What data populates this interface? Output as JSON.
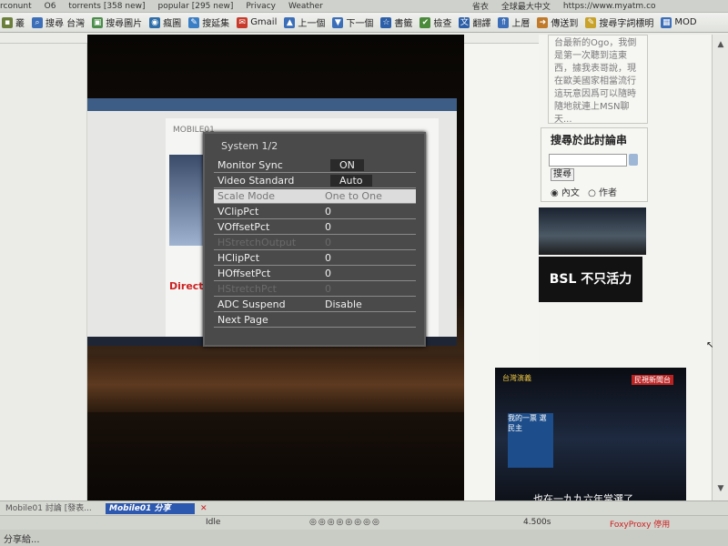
{
  "browser": {
    "top_bookmarks": [
      "rconunt",
      "O6",
      "torrents [358 new]",
      "popular [295 new]",
      "Privacy",
      "Weather",
      "省衣",
      "全球最大中文",
      "https://www.myatm.co"
    ],
    "toolbar": [
      {
        "icon": "fold-icon",
        "label": "叢"
      },
      {
        "icon": "search-icon",
        "label": "搜尋 台灣"
      },
      {
        "icon": "image-icon",
        "label": "搜尋圖片"
      },
      {
        "icon": "blog-icon",
        "label": "瘋圖"
      },
      {
        "icon": "bookmark-icon",
        "label": "搜延集"
      },
      {
        "icon": "gmail-icon",
        "label": "Gmail"
      },
      {
        "icon": "up-icon",
        "label": "上一個"
      },
      {
        "icon": "down-icon",
        "label": "下一個"
      },
      {
        "icon": "star-icon",
        "label": "書籤"
      },
      {
        "icon": "check-icon",
        "label": "檢查"
      },
      {
        "icon": "translate-icon",
        "label": "翻譯"
      },
      {
        "icon": "upload-icon",
        "label": "上層"
      },
      {
        "icon": "send-icon",
        "label": "傳送到"
      },
      {
        "icon": "spell-icon",
        "label": "搜尋字詞標明"
      },
      {
        "icon": "mod-icon",
        "label": "MOD"
      }
    ]
  },
  "osd": {
    "title": "System 1/2",
    "rows": [
      {
        "label": "Monitor Sync",
        "value": "ON",
        "state": "boxed"
      },
      {
        "label": "Video Standard",
        "value": "Auto",
        "state": "boxed"
      },
      {
        "label": "Scale Mode",
        "value": "One to One",
        "state": "selected"
      },
      {
        "label": "VClipPct",
        "value": "0",
        "state": "normal"
      },
      {
        "label": "VOffsetPct",
        "value": "0",
        "state": "normal"
      },
      {
        "label": "HStretchOutput",
        "value": "0",
        "state": "disabled"
      },
      {
        "label": "HClipPct",
        "value": "0",
        "state": "normal"
      },
      {
        "label": "HOffsetPct",
        "value": "0",
        "state": "normal"
      },
      {
        "label": "HStretchPct",
        "value": "0",
        "state": "disabled"
      },
      {
        "label": "ADC Suspend",
        "value": "Disable",
        "state": "normal"
      },
      {
        "label": "Next Page",
        "value": "",
        "state": "normal"
      }
    ]
  },
  "monitor_page": {
    "logo": "MOBILE01",
    "ad": "Direct."
  },
  "sidebar": {
    "snippet": "台最新的Ogo，我倒是第一次聽到這東西，據我表哥說，現在歐美國家相當流行這玩意因爲可以隨時隨地就連上MSN聊天...",
    "search_title": "搜尋於此討論串",
    "search_button": "搜尋",
    "radio_content": "內文",
    "radio_author": "作者",
    "bsl_text": "BSL 不只活力"
  },
  "tv": {
    "logo": "台灣演義",
    "channel": "民視新聞台",
    "subtitle": "也在一九九六年當選了",
    "banner": "我的一票 選民主"
  },
  "taskbar": {
    "tab1": "Mobile01 討論 [發表...",
    "tab2": "Mobile01 分享"
  },
  "status": {
    "left": "Idle",
    "mid": "4.500s",
    "proxy": "FoxyProxy 停用"
  },
  "bottom": {
    "left": "分享給..."
  }
}
